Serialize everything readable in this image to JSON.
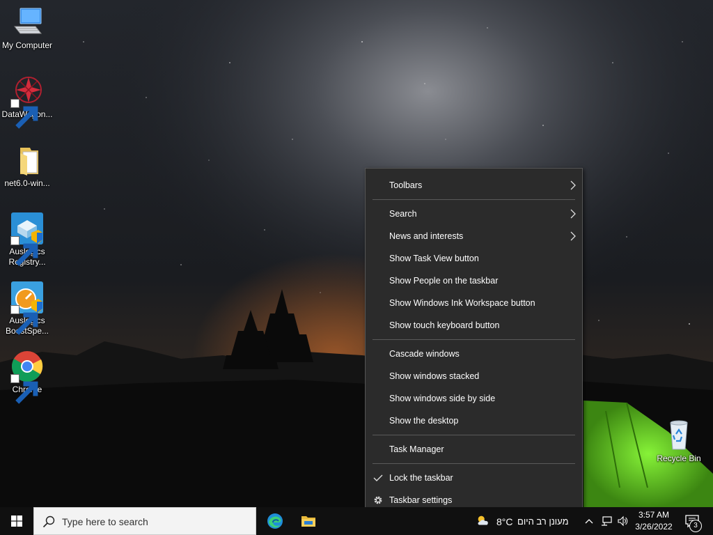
{
  "desktop": {
    "icons": [
      {
        "label": "My Computer",
        "icon": "computer-icon"
      },
      {
        "label": "DataWagon...",
        "icon": "datawagon-icon"
      },
      {
        "label": "net6.0-win...",
        "icon": "folder-icon"
      },
      {
        "label": "Auslogics Registry...",
        "label_line1": "Auslogics",
        "label_line2": "Registry...",
        "icon": "registry-cleaner-icon"
      },
      {
        "label": "Auslogics BoostSpe...",
        "label_line1": "Auslogics",
        "label_line2": "BoostSpe...",
        "icon": "boostspeed-icon"
      },
      {
        "label": "Chrome",
        "icon": "chrome-icon"
      },
      {
        "label": "Recycle Bin",
        "icon": "recycle-bin-icon"
      }
    ]
  },
  "context_menu": {
    "items": [
      {
        "label": "Toolbars",
        "submenu": true
      },
      {
        "label": "Search",
        "submenu": true
      },
      {
        "label": "News and interests",
        "submenu": true
      },
      {
        "label": "Show Task View button"
      },
      {
        "label": "Show People on the taskbar"
      },
      {
        "label": "Show Windows Ink Workspace button"
      },
      {
        "label": "Show touch keyboard button"
      },
      {
        "label": "Cascade windows"
      },
      {
        "label": "Show windows stacked"
      },
      {
        "label": "Show windows side by side"
      },
      {
        "label": "Show the desktop"
      },
      {
        "label": "Task Manager"
      },
      {
        "label": "Lock the taskbar",
        "checked": true
      },
      {
        "label": "Taskbar settings",
        "icon": "gear-icon"
      }
    ]
  },
  "taskbar": {
    "search_placeholder": "Type here to search",
    "pinned": [
      "edge-icon",
      "file-explorer-icon"
    ],
    "weather": {
      "temp": "8°C",
      "text": "מעונן רב היום",
      "icon": "partly-cloudy-icon"
    },
    "tray_icons": [
      "chevron-up-icon",
      "network-icon",
      "volume-icon"
    ],
    "time": "3:57 AM",
    "date": "3/26/2022",
    "notification_count": "3"
  },
  "colors": {
    "menu_bg": "#2b2b2b",
    "taskbar_bg": "#101010",
    "tent_green": "#5fbf1f"
  }
}
